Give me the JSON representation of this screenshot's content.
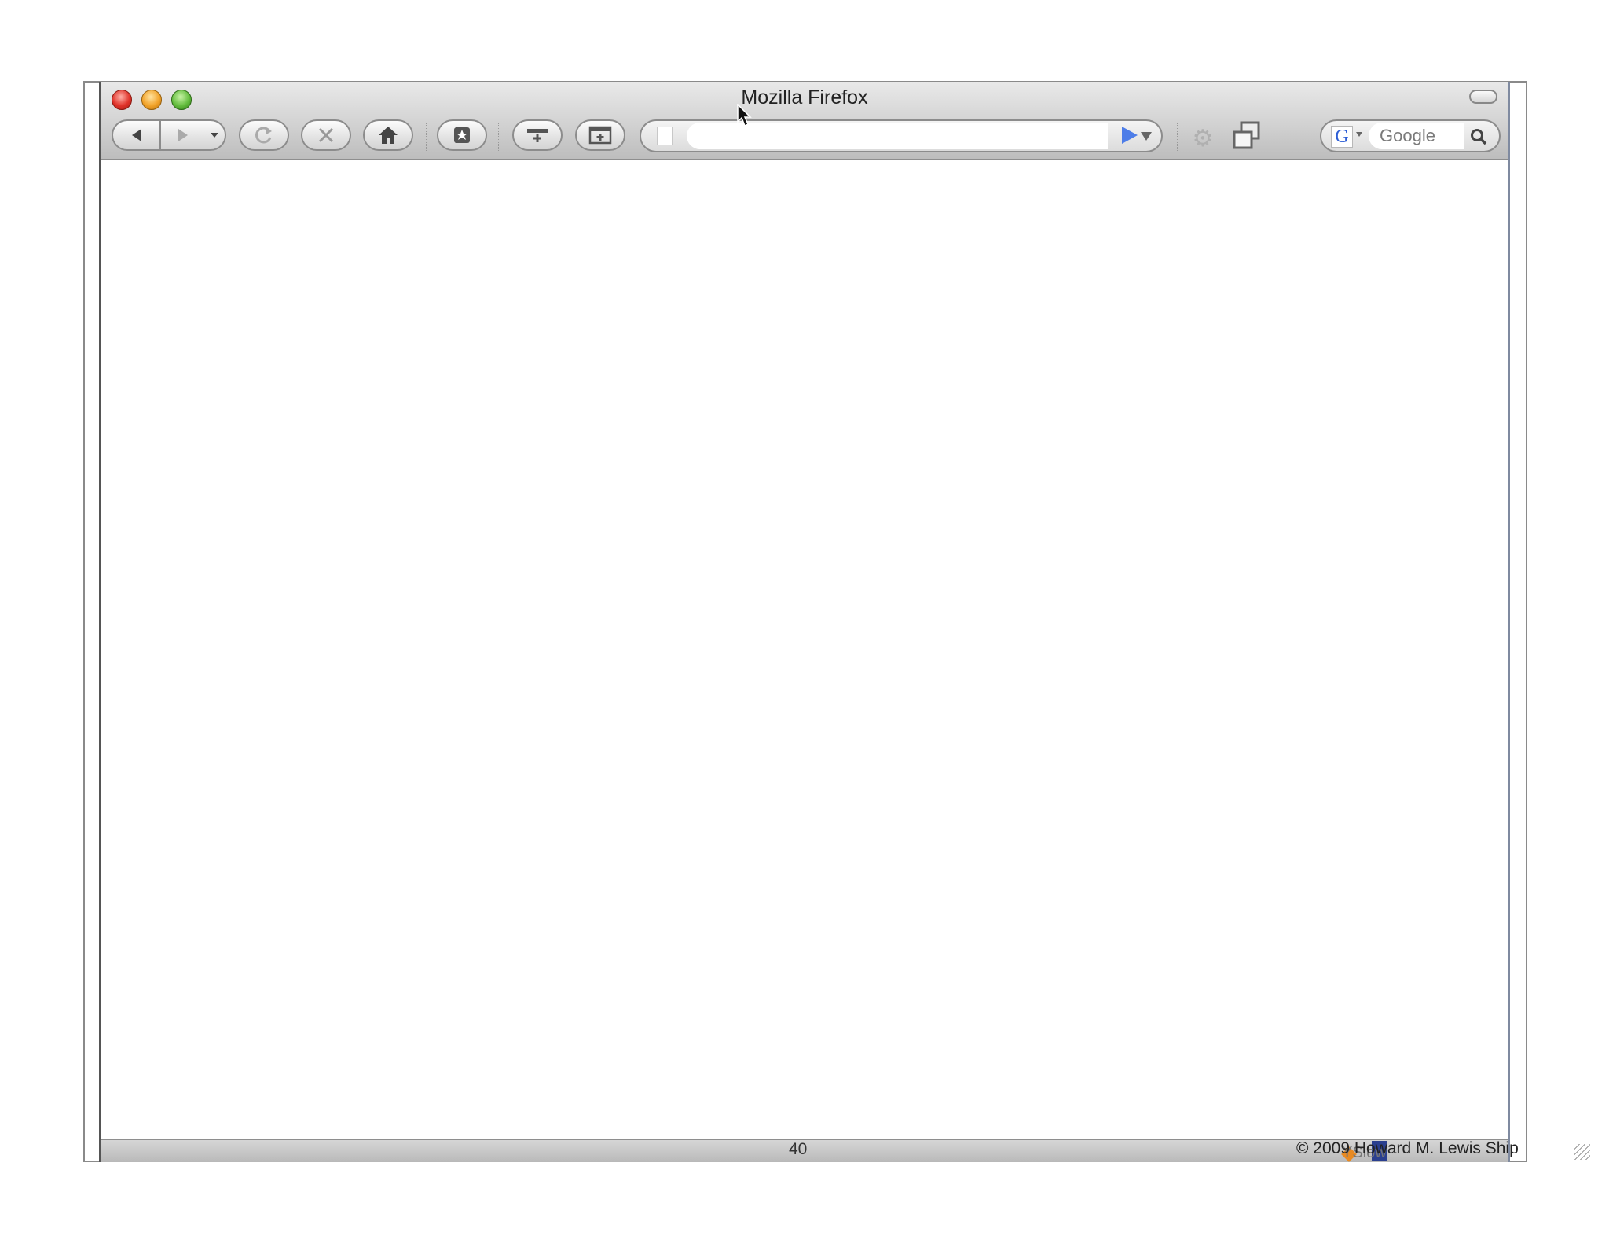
{
  "window": {
    "title": "Mozilla Firefox"
  },
  "toolbar": {
    "back_icon": "back-arrow-icon",
    "forward_icon": "forward-arrow-icon",
    "reload_icon": "reload-icon",
    "stop_icon": "stop-icon",
    "home_icon": "home-icon"
  },
  "url_bar": {
    "value": ""
  },
  "search": {
    "engine_letter": "G",
    "placeholder": "Google"
  },
  "status_bar": {
    "addon_label": "YSlow"
  },
  "slide": {
    "number": "40",
    "copyright": "© 2009 Howard M. Lewis Ship"
  },
  "colors": {
    "close": "#e0332a",
    "minimize": "#f2a32a",
    "maximize": "#64bd3e",
    "go_arrow": "#4d7de8"
  }
}
